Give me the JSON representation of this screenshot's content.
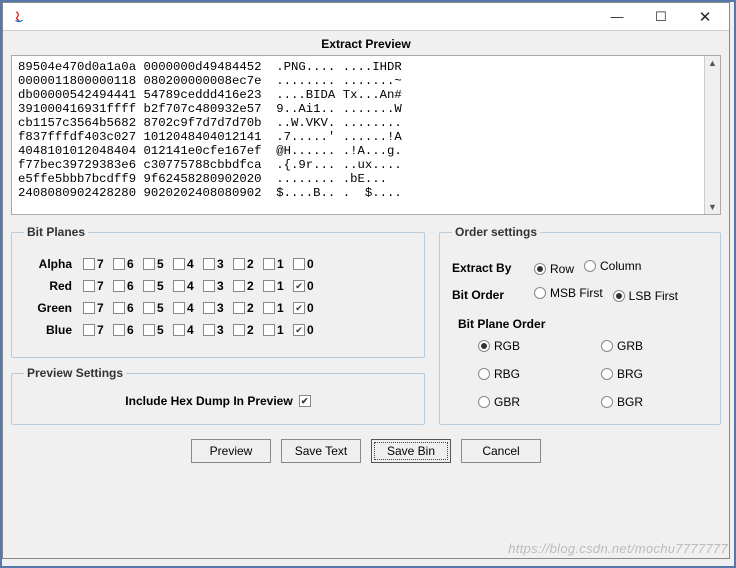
{
  "titlebar": {
    "min": "—",
    "max": "☐",
    "close": "✕"
  },
  "preview": {
    "title": "Extract Preview",
    "lines": [
      "89504e470d0a1a0a 0000000d49484452  .PNG.... ....IHDR",
      "0000011800000118 080200000008ec7e  ........ .......~",
      "db00000542494441 54789ceddd416e23  ....BIDA Tx...An#",
      "391000416931ffff b2f707c480932e57  9..Ai1.. .......W",
      "cb1157c3564b5682 8702c9f7d7d7d70b  ..W.VKV. ........",
      "f837fffdf403c027 1012048404012141  .7.....' ......!A",
      "4048101012048404 012141e0cfe167ef  @H...... .!A...g.",
      "f77bec39729383e6 c30775788cbbdfca  .{.9r... ..ux....",
      "e5ffe5bbb7bcdff9 9f62458280902020  ........ .bE... ",
      "2408080902428280 9020202408080902  $....B.. .  $....",
      ""
    ]
  },
  "bitplanes": {
    "legend": "Bit Planes",
    "channels": [
      "Alpha",
      "Red",
      "Green",
      "Blue"
    ],
    "bits": [
      "7",
      "6",
      "5",
      "4",
      "3",
      "2",
      "1",
      "0"
    ],
    "checked": {
      "Alpha": [],
      "Red": [
        "0"
      ],
      "Green": [
        "0"
      ],
      "Blue": [
        "0"
      ]
    }
  },
  "previewSettings": {
    "legend": "Preview Settings",
    "label": "Include Hex Dump In Preview",
    "checked": true
  },
  "orderSettings": {
    "legend": "Order settings",
    "extractBy": {
      "label": "Extract By",
      "options": [
        "Row",
        "Column"
      ],
      "selected": "Row"
    },
    "bitOrder": {
      "label": "Bit Order",
      "options": [
        "MSB First",
        "LSB First"
      ],
      "selected": "LSB First"
    },
    "bitPlaneOrder": {
      "label": "Bit Plane Order",
      "options": [
        "RGB",
        "GRB",
        "RBG",
        "BRG",
        "GBR",
        "BGR"
      ],
      "selected": "RGB"
    }
  },
  "buttons": {
    "preview": "Preview",
    "saveText": "Save Text",
    "saveBin": "Save Bin",
    "cancel": "Cancel"
  },
  "watermark": "https://blog.csdn.net/mochu7777777"
}
